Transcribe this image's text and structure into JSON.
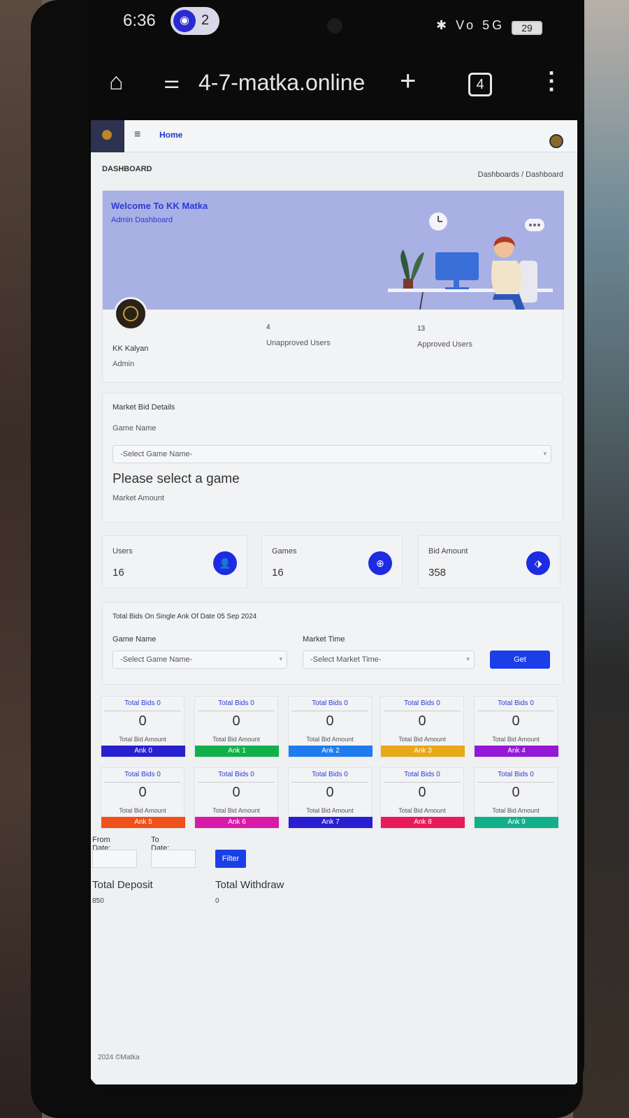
{
  "status": {
    "time": "6:36",
    "hotspot_count": "2",
    "battery": "29",
    "net": "5G"
  },
  "browser": {
    "url": "4-7-matka.online",
    "tab_count": "4"
  },
  "nav": {
    "home": "Home"
  },
  "header": {
    "title": "DASHBOARD",
    "crumb_1": "Dashboards",
    "crumb_sep": "/",
    "crumb_2": "Dashboard"
  },
  "welcome": {
    "title": "Welcome To KK Matka",
    "subtitle": "Admin Dashboard",
    "user_name": "KK Kalyan",
    "user_role": "Admin",
    "unapproved_count": "4",
    "unapproved_label": "Unapproved Users",
    "approved_count": "13",
    "approved_label": "Approved Users"
  },
  "market_bid": {
    "title": "Market Bid Details",
    "game_label": "Game Name",
    "select_placeholder": "-Select Game Name-",
    "message": "Please select a game",
    "amount_label": "Market Amount"
  },
  "stats": [
    {
      "label": "Users",
      "value": "16",
      "icon": "user-icon"
    },
    {
      "label": "Games",
      "value": "16",
      "icon": "game-icon"
    },
    {
      "label": "Bid Amount",
      "value": "358",
      "icon": "tag-icon"
    }
  ],
  "ank_filter": {
    "title": "Total Bids On Single Ank Of Date 05 Sep 2024",
    "game_label": "Game Name",
    "game_placeholder": "-Select Game Name-",
    "time_label": "Market Time",
    "time_placeholder": "-Select Market Time-",
    "get_label": "Get"
  },
  "anks": [
    {
      "top": "Total Bids 0",
      "value": "0",
      "amount_label": "Total Bid Amount",
      "name": "Ank 0",
      "color": "#2a1fd0"
    },
    {
      "top": "Total Bids 0",
      "value": "0",
      "amount_label": "Total Bid Amount",
      "name": "Ank 1",
      "color": "#12b04a"
    },
    {
      "top": "Total Bids 0",
      "value": "0",
      "amount_label": "Total Bid Amount",
      "name": "Ank 2",
      "color": "#1e7cf0"
    },
    {
      "top": "Total Bids 0",
      "value": "0",
      "amount_label": "Total Bid Amount",
      "name": "Ank 3",
      "color": "#e8a818"
    },
    {
      "top": "Total Bids 0",
      "value": "0",
      "amount_label": "Total Bid Amount",
      "name": "Ank 4",
      "color": "#9418d8"
    },
    {
      "top": "Total Bids 0",
      "value": "0",
      "amount_label": "Total Bid Amount",
      "name": "Ank 5",
      "color": "#f0501a"
    },
    {
      "top": "Total Bids 0",
      "value": "0",
      "amount_label": "Total Bid Amount",
      "name": "Ank 6",
      "color": "#d81aa8"
    },
    {
      "top": "Total Bids 0",
      "value": "0",
      "amount_label": "Total Bid Amount",
      "name": "Ank 7",
      "color": "#2a1fd0"
    },
    {
      "top": "Total Bids 0",
      "value": "0",
      "amount_label": "Total Bid Amount",
      "name": "Ank 8",
      "color": "#e81a5a"
    },
    {
      "top": "Total Bids 0",
      "value": "0",
      "amount_label": "Total Bid Amount",
      "name": "Ank 9",
      "color": "#12b08a"
    }
  ],
  "dates": {
    "from_label": "From Date:",
    "to_label": "To Date:",
    "filter_label": "Filter"
  },
  "totals": {
    "deposit_label": "Total Deposit",
    "deposit_value": "850",
    "withdraw_label": "Total Withdraw",
    "withdraw_value": "0"
  },
  "footer": {
    "text": "2024 ©Matka"
  }
}
